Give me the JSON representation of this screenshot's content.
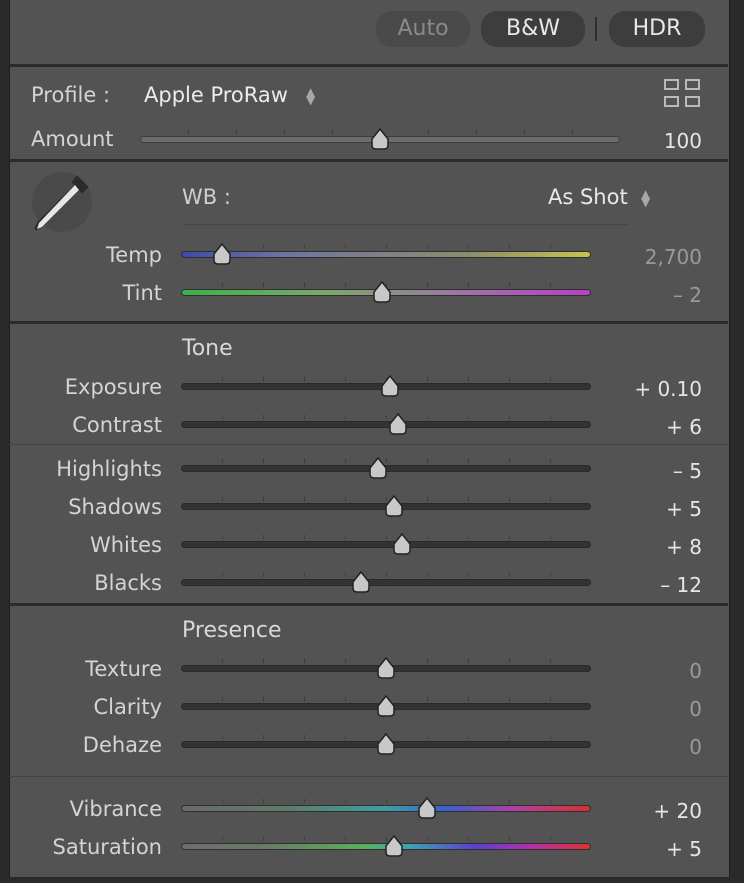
{
  "top_buttons": {
    "auto": "Auto",
    "bw": "B&W",
    "hdr": "HDR"
  },
  "profile": {
    "label": "Profile :",
    "value": "Apple ProRaw",
    "amount_label": "Amount",
    "amount_value": "100"
  },
  "wb": {
    "label": "WB :",
    "value": "As Shot"
  },
  "sliders": {
    "temp": {
      "label": "Temp",
      "value": "2,700",
      "level": 0.1
    },
    "tint": {
      "label": "Tint",
      "value": "– 2",
      "level": 0.49
    },
    "exposure": {
      "label": "Exposure",
      "value": "+ 0.10",
      "level": 0.51
    },
    "contrast": {
      "label": "Contrast",
      "value": "+ 6",
      "level": 0.53
    },
    "highlights": {
      "label": "Highlights",
      "value": "– 5",
      "level": 0.48
    },
    "shadows": {
      "label": "Shadows",
      "value": "+ 5",
      "level": 0.52
    },
    "whites": {
      "label": "Whites",
      "value": "+ 8",
      "level": 0.54
    },
    "blacks": {
      "label": "Blacks",
      "value": "– 12",
      "level": 0.44
    },
    "texture": {
      "label": "Texture",
      "value": "0",
      "level": 0.5
    },
    "clarity": {
      "label": "Clarity",
      "value": "0",
      "level": 0.5
    },
    "dehaze": {
      "label": "Dehaze",
      "value": "0",
      "level": 0.5
    },
    "vibrance": {
      "label": "Vibrance",
      "value": "+ 20",
      "level": 0.6
    },
    "saturation": {
      "label": "Saturation",
      "value": "+ 5",
      "level": 0.52
    },
    "amount": {
      "level": 0.5
    }
  },
  "sections": {
    "tone": "Tone",
    "presence": "Presence"
  },
  "icons": {
    "dropper": "eyedropper-icon",
    "grid": "profile-browser-grid-icon",
    "updown": "updown-arrows-icon"
  }
}
